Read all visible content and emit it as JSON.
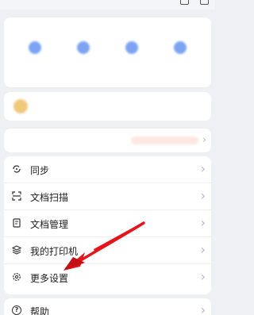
{
  "menu": {
    "items": [
      {
        "label": "同步",
        "icon": "sync-icon"
      },
      {
        "label": "文档扫描",
        "icon": "scan-icon"
      },
      {
        "label": "文档管理",
        "icon": "document-icon"
      },
      {
        "label": "我的打印机",
        "icon": "layers-icon"
      },
      {
        "label": "更多设置",
        "icon": "gear-icon"
      }
    ]
  },
  "help": {
    "label": "帮助",
    "icon": "help-icon"
  },
  "colors": {
    "arrow": "#e3161c",
    "accent": "#5b8df0",
    "background": "#eef0f3"
  }
}
